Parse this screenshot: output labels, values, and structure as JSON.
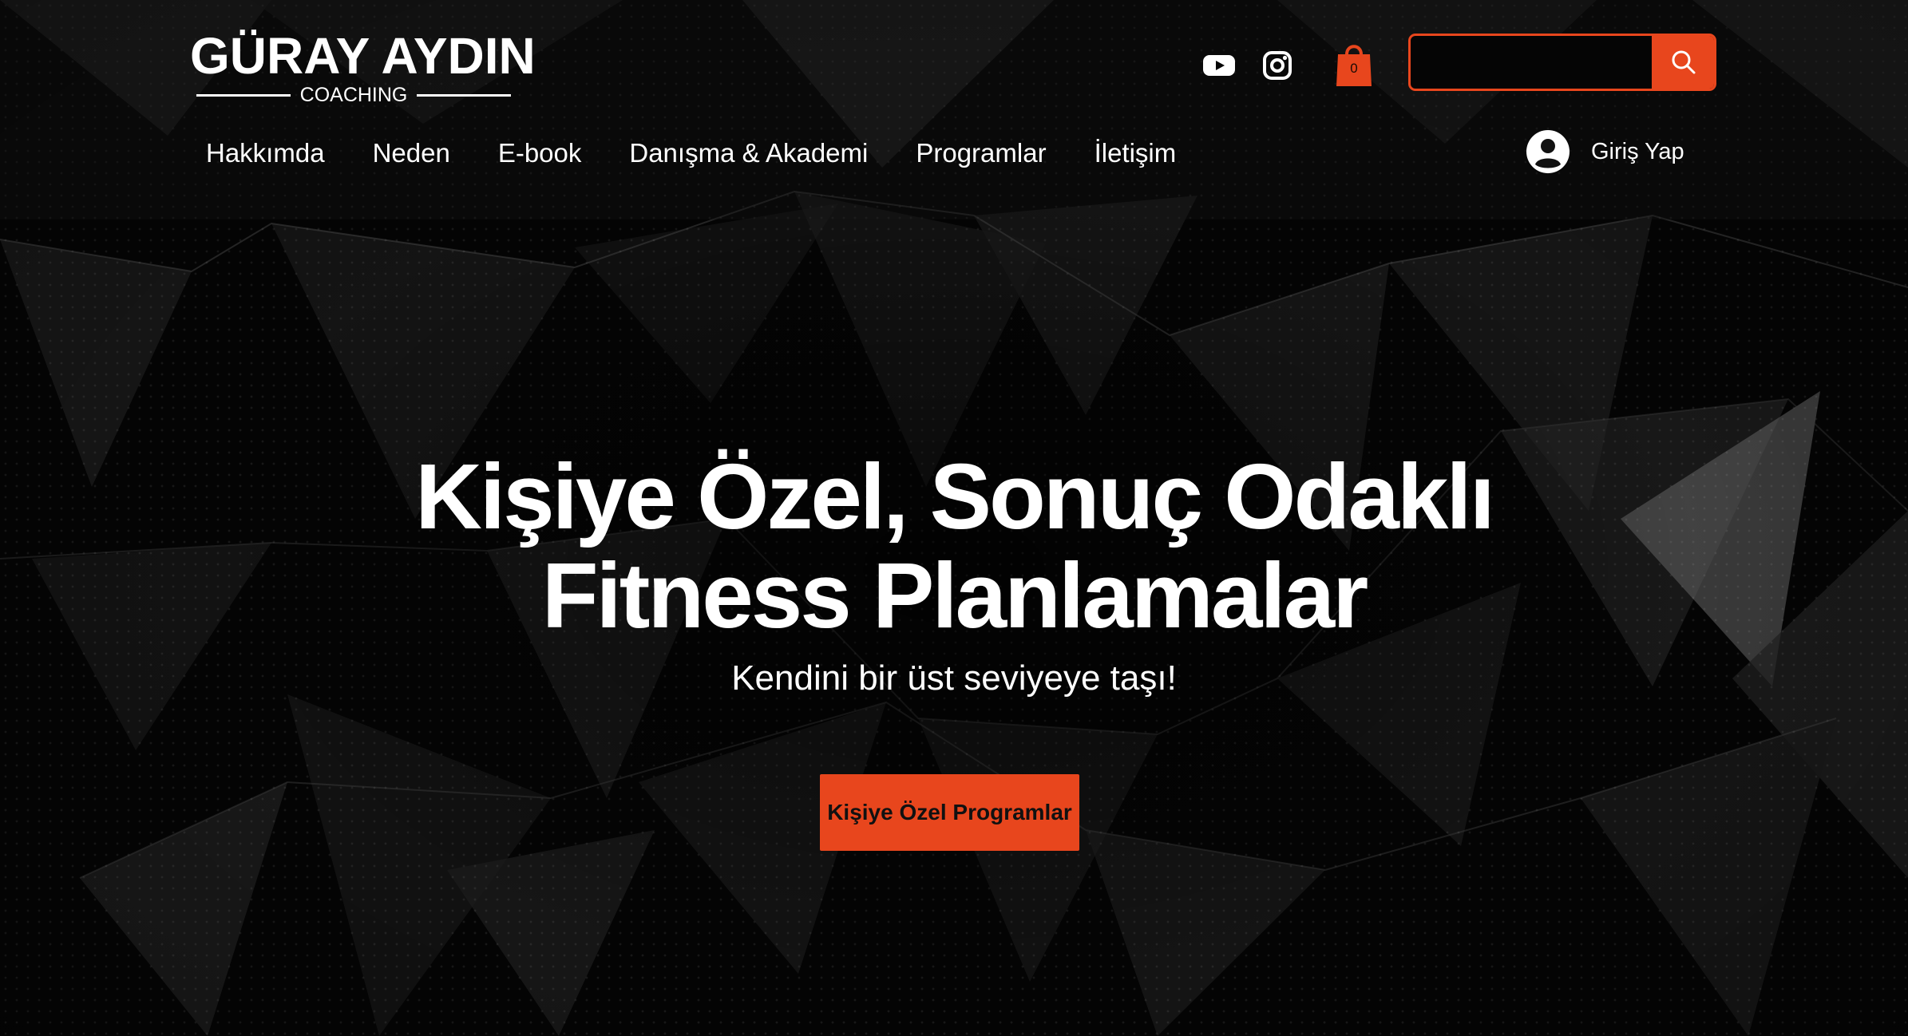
{
  "brand": {
    "name": "GÜRAY AYDIN",
    "tagline": "COACHING",
    "accent_color": "#e8461d",
    "background_color": "#060606",
    "text_color": "#ffffff"
  },
  "header": {
    "social_links": [
      {
        "icon": "youtube-icon"
      },
      {
        "icon": "instagram-icon"
      }
    ],
    "cart": {
      "icon": "shopping-bag-icon",
      "count": "0"
    },
    "search": {
      "value": "",
      "placeholder": "",
      "icon": "search-icon"
    },
    "login": {
      "icon": "user-avatar-icon",
      "label": "Giriş Yap"
    }
  },
  "nav": {
    "items": [
      {
        "label": "Hakkımda"
      },
      {
        "label": "Neden"
      },
      {
        "label": "E-book"
      },
      {
        "label": "Danışma & Akademi"
      },
      {
        "label": "Programlar"
      },
      {
        "label": "İletişim"
      }
    ]
  },
  "hero": {
    "title_line_1": "Kişiye Özel, Sonuç Odaklı",
    "title_line_2": "Fitness Planlamalar",
    "subtitle": "Kendini bir üst seviyeye taşı!",
    "cta_label": "Kişiye Özel Programlar"
  }
}
